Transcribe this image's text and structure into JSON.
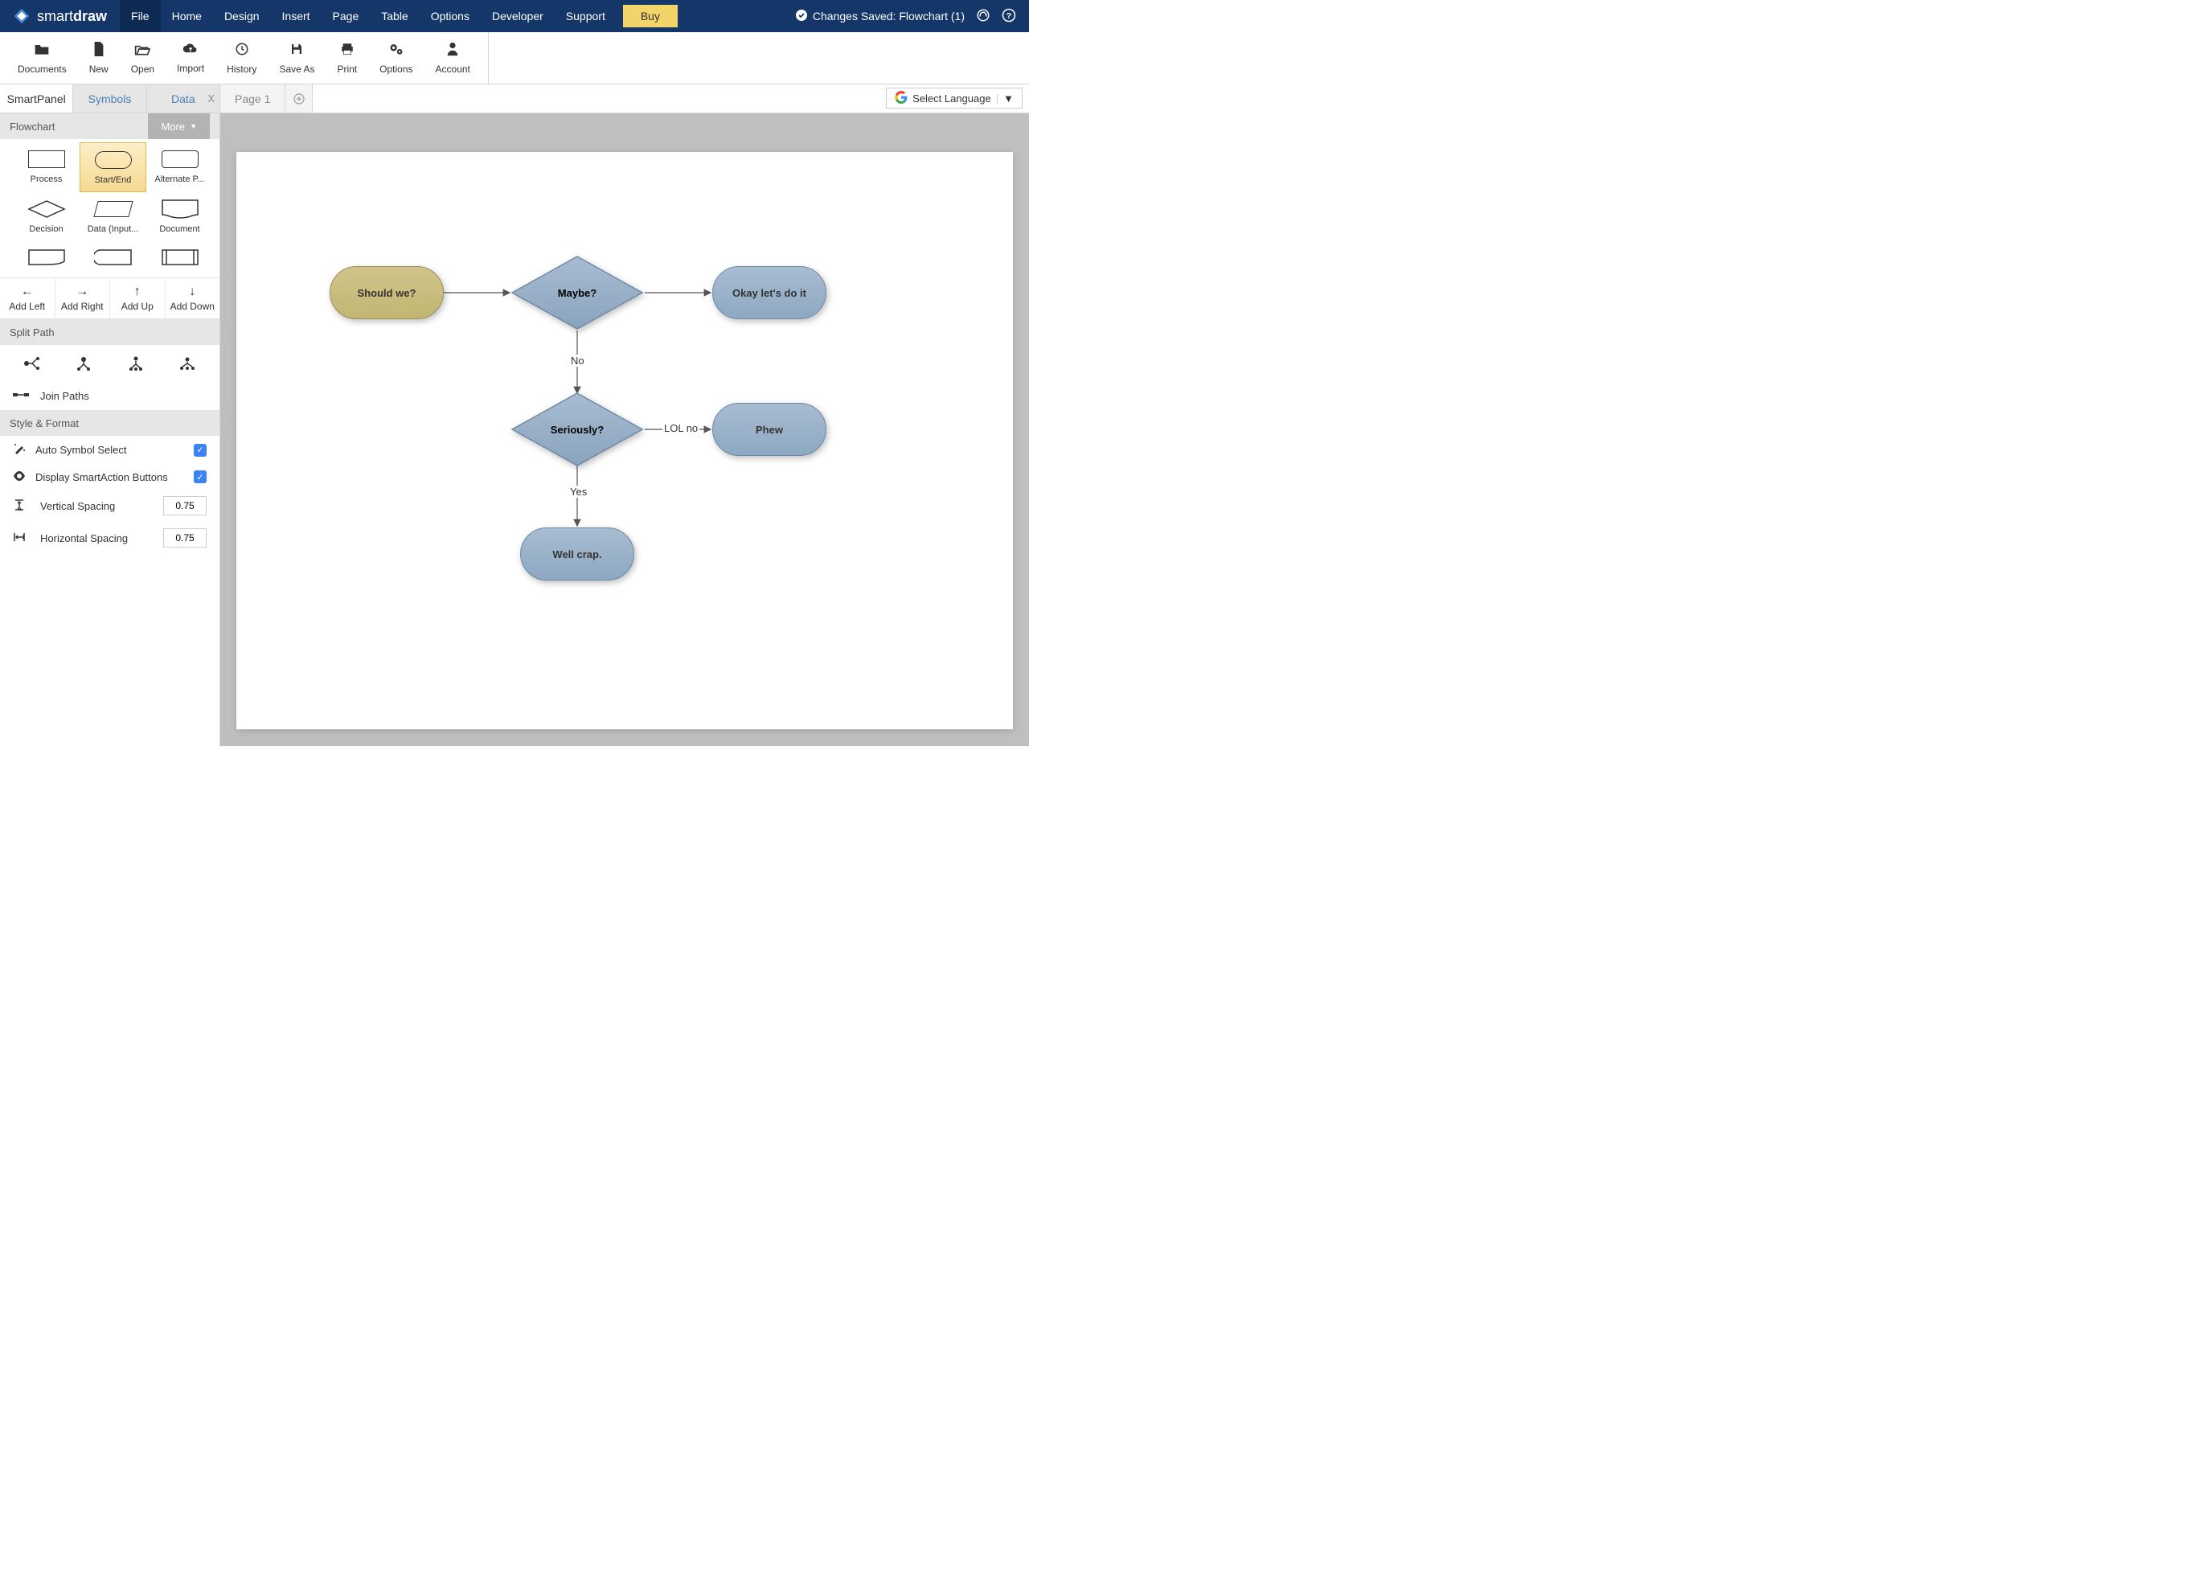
{
  "brand": {
    "name1": "smart",
    "name2": "draw"
  },
  "menu": {
    "items": [
      "File",
      "Home",
      "Design",
      "Insert",
      "Page",
      "Table",
      "Options",
      "Developer",
      "Support"
    ],
    "buy": "Buy"
  },
  "status": {
    "saved_label": "Changes Saved: Flowchart (1)"
  },
  "toolbar": {
    "documents": "Documents",
    "new": "New",
    "open": "Open",
    "import": "Import",
    "history": "History",
    "saveas": "Save As",
    "print": "Print",
    "options": "Options",
    "account": "Account"
  },
  "side_tabs": {
    "smartpanel": "SmartPanel",
    "symbols": "Symbols",
    "data": "Data"
  },
  "page_tabs": {
    "page1": "Page 1"
  },
  "lang": {
    "label": "Select Language"
  },
  "shapes_panel": {
    "title": "Flowchart",
    "more": "More",
    "shapes": [
      {
        "label": "Process"
      },
      {
        "label": "Start/End"
      },
      {
        "label": "Alternate P..."
      },
      {
        "label": "Decision"
      },
      {
        "label": "Data (Input..."
      },
      {
        "label": "Document"
      }
    ],
    "add": {
      "left": "Add Left",
      "right": "Add Right",
      "up": "Add Up",
      "down": "Add Down"
    },
    "split_title": "Split Path",
    "join": "Join Paths",
    "style_title": "Style & Format",
    "auto_symbol": "Auto Symbol Select",
    "display_smartaction": "Display SmartAction Buttons",
    "vspacing_label": "Vertical Spacing",
    "vspacing_val": "0.75",
    "hspacing_label": "Horizontal Spacing",
    "hspacing_val": "0.75"
  },
  "flowchart": {
    "nodes": {
      "start": "Should we?",
      "maybe": "Maybe?",
      "okay": "Okay let's do it",
      "seriously": "Seriously?",
      "phew": "Phew",
      "wellcrap": "Well crap."
    },
    "edges": {
      "no": "No",
      "lolno": "LOL no",
      "yes": "Yes"
    }
  }
}
